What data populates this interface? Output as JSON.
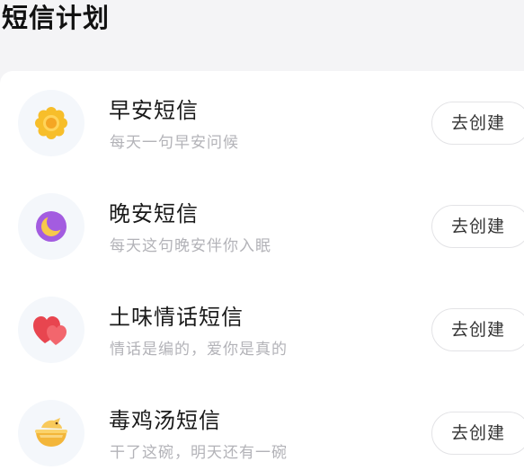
{
  "header": {
    "title": "短信计划"
  },
  "plans": [
    {
      "name": "早安短信",
      "desc": "每天一句早安问候",
      "button_label": "去创建",
      "icon": "sun-flower-icon",
      "icon_color": "#f5b21b"
    },
    {
      "name": "晚安短信",
      "desc": "每天这句晚安伴你入眠",
      "button_label": "去创建",
      "icon": "moon-icon",
      "icon_color": "#9b59d6"
    },
    {
      "name": "土味情话短信",
      "desc": "情话是编的，爱你是真的",
      "button_label": "去创建",
      "icon": "hearts-icon",
      "icon_color": "#e8454f"
    },
    {
      "name": "毒鸡汤短信",
      "desc": "干了这碗，明天还有一碗",
      "button_label": "去创建",
      "icon": "soup-bowl-icon",
      "icon_color": "#f3b63a"
    }
  ]
}
